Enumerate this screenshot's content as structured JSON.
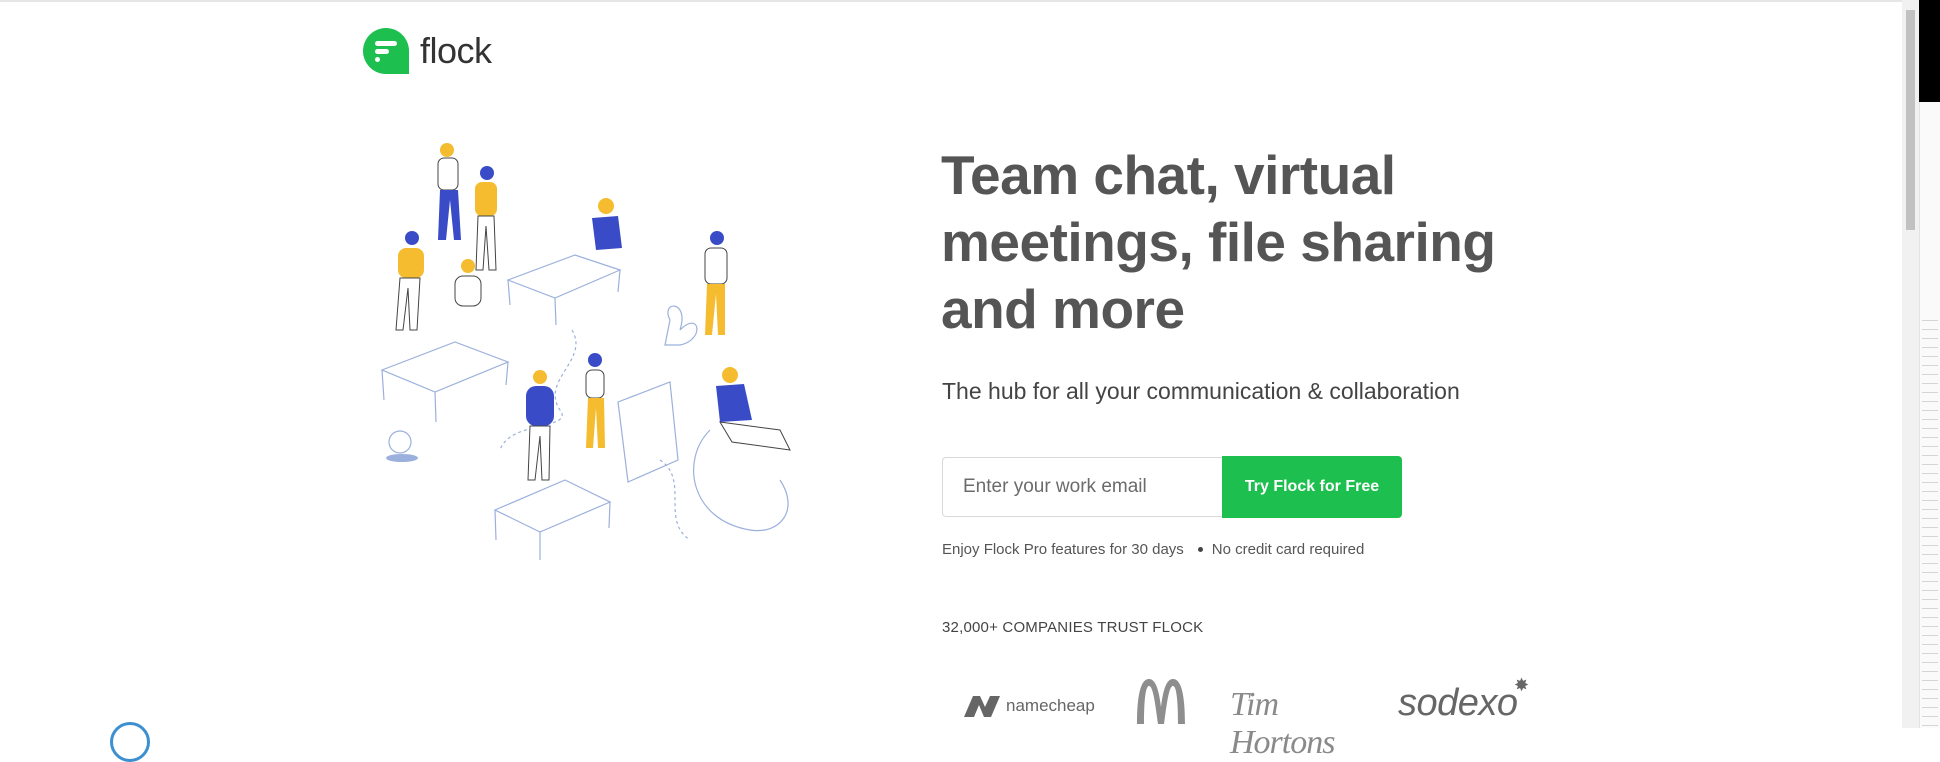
{
  "brand": {
    "name": "flock",
    "green": "#1dbf4e"
  },
  "hero": {
    "headline_lines": [
      "Team chat, virtual",
      "meetings, file sharing",
      "and more"
    ],
    "subheadline": "The hub for all your communication & collaboration"
  },
  "signup": {
    "email_placeholder": "Enter your work email",
    "cta_label": "Try Flock for Free",
    "notes": [
      "Enjoy Flock Pro features for 30 days",
      "No credit card required"
    ]
  },
  "trust": {
    "heading": "32,000+ COMPANIES TRUST FLOCK",
    "logos": [
      "namecheap",
      "McDonald's",
      "Tim Hortons",
      "sodexo"
    ]
  },
  "icons": {
    "brand_logo": "flock-chat-bubble-icon",
    "illustration": "team-collaboration-illustration"
  }
}
